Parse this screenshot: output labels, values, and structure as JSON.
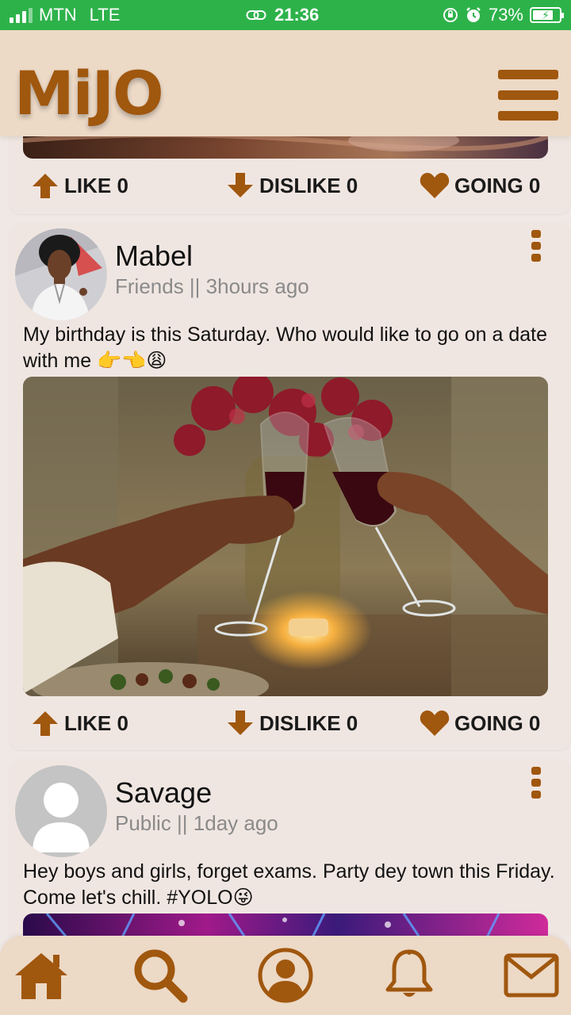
{
  "status_bar": {
    "carrier": "MTN",
    "network": "LTE",
    "time": "21:36",
    "battery": "73%",
    "icons": [
      "signal-icon",
      "link-icon",
      "rotation-lock-icon",
      "alarm-icon",
      "battery-charging-icon"
    ]
  },
  "header": {
    "logo": "MiJO",
    "menu_icon": "hamburger-menu-icon"
  },
  "colors": {
    "accent": "#a0570e",
    "header_bg": "#ecd9c6",
    "status_green": "#2db24a",
    "card_bg": "#f0e6e1"
  },
  "posts": [
    {
      "actions": {
        "like": "LIKE 0",
        "dislike": "DISLIKE 0",
        "going": "GOING 0"
      }
    },
    {
      "author": "Mabel",
      "meta": "Friends || 3hours ago",
      "text": "My birthday is this Saturday. Who would like to go on a date with me 👉👈😩",
      "image": "wine-toast-photo",
      "actions": {
        "like": "LIKE 0",
        "dislike": "DISLIKE 0",
        "going": "GOING 0"
      }
    },
    {
      "author": "Savage",
      "meta": "Public || 1day ago",
      "text": "Hey boys and girls, forget exams. Party dey town this Friday. Come let's chill. #YOLO😜",
      "image": "party-lights-photo"
    }
  ],
  "bottom_nav": [
    "home-icon",
    "search-icon",
    "profile-icon",
    "bell-icon",
    "mail-icon"
  ]
}
